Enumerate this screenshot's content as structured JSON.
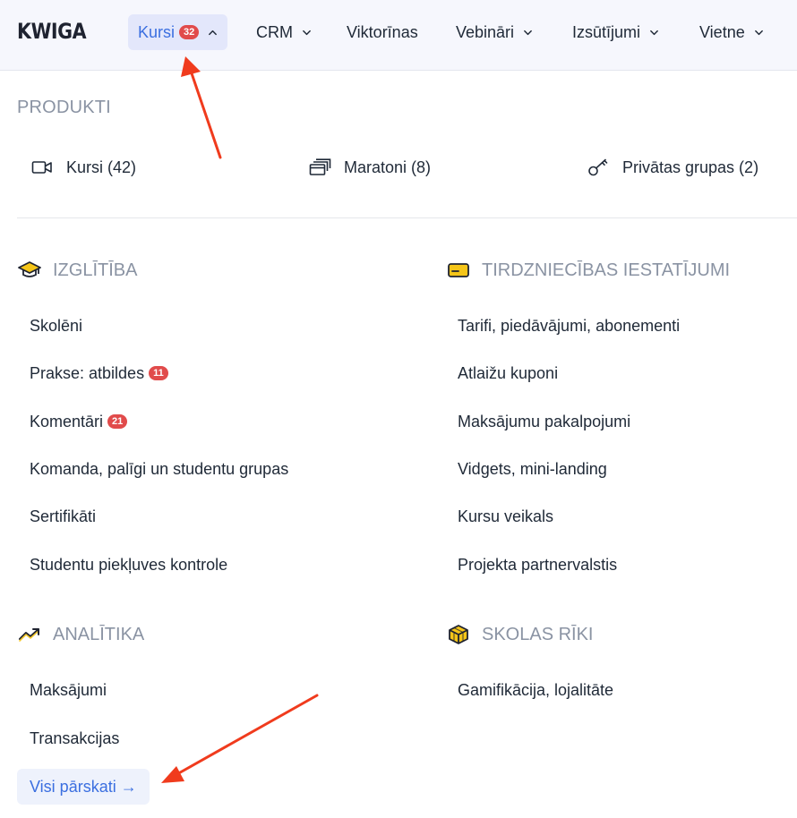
{
  "header": {
    "logo": "KWIGA",
    "nav": [
      {
        "label": "Kursi",
        "badge": "32",
        "chevron": "up",
        "active": true
      },
      {
        "label": "CRM",
        "chevron": "down"
      },
      {
        "label": "Viktorīnas"
      },
      {
        "label": "Vebināri",
        "chevron": "down"
      },
      {
        "label": "Izsūtījumi",
        "chevron": "down"
      },
      {
        "label": "Vietne",
        "chevron": "down"
      }
    ]
  },
  "products": {
    "title": "PRODUKTI",
    "items": [
      {
        "label": "Kursi (42)",
        "icon": "video-camera-icon"
      },
      {
        "label": "Maratoni (8)",
        "icon": "stacked-windows-icon"
      },
      {
        "label": "Privātas grupas (2)",
        "icon": "key-icon"
      }
    ]
  },
  "education": {
    "title": "IZGLĪTĪBA",
    "icon": "graduation-cap-icon",
    "items": [
      {
        "label": "Skolēni"
      },
      {
        "label": "Prakse: atbildes",
        "badge": "11"
      },
      {
        "label": "Komentāri",
        "badge": "21"
      },
      {
        "label": "Komanda, palīgi un studentu grupas"
      },
      {
        "label": "Sertifikāti"
      },
      {
        "label": "Studentu piekļuves kontrole"
      }
    ]
  },
  "sales": {
    "title": "TIRDZNIECĪBAS IESTATĪJUMI",
    "icon": "credit-card-icon",
    "items": [
      {
        "label": "Tarifi, piedāvājumi, abonementi"
      },
      {
        "label": "Atlaižu kuponi"
      },
      {
        "label": "Maksājumu pakalpojumi"
      },
      {
        "label": "Vidgets, mini-landing"
      },
      {
        "label": "Kursu veikals"
      },
      {
        "label": "Projekta partnervalstis"
      }
    ]
  },
  "analytics": {
    "title": "ANALĪTIKA",
    "icon": "trending-up-icon",
    "items": [
      {
        "label": "Maksājumi"
      },
      {
        "label": "Transakcijas"
      }
    ],
    "all_reports": "Visi pārskati →"
  },
  "tools": {
    "title": "SKOLAS RĪKI",
    "icon": "cube-box-icon",
    "items": [
      {
        "label": "Gamifikācija, lojalitāte"
      }
    ]
  },
  "colors": {
    "accent": "#3b6fe0",
    "badge": "#e14b4b",
    "annotation_arrow": "#f03b1d",
    "muted_heading": "#8a93a3"
  }
}
